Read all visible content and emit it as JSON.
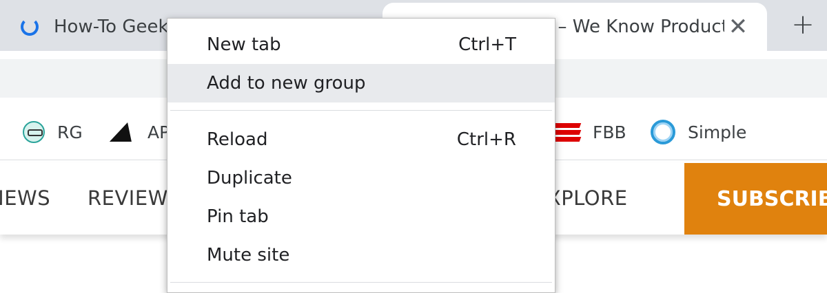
{
  "tabs": [
    {
      "title": "How-To Geek – We Explain Technology",
      "active": false,
      "loading": true
    },
    {
      "title": "Review Geek – We Know Products",
      "active": true
    }
  ],
  "tab_close_glyph": "✕",
  "new_tab_glyph": "+",
  "bookmarks": [
    {
      "label": "RG",
      "icon": "review-geek-icon"
    },
    {
      "label": "AP",
      "icon": "android-police-icon"
    },
    {
      "label": "FBB",
      "icon": "espn-icon"
    },
    {
      "label": "Simple",
      "icon": "simple-icon"
    }
  ],
  "site_nav": {
    "items": [
      "NEWS",
      "REVIEWS",
      "EXPLORE"
    ],
    "subscribe_label": "SUBSCRIBE",
    "subscribe_color": "#e0820e"
  },
  "context_menu": {
    "items": [
      {
        "label": "New tab",
        "shortcut": "Ctrl+T"
      },
      {
        "label": "Add to new group",
        "shortcut": "",
        "highlighted": true
      },
      {
        "label": "Reload",
        "shortcut": "Ctrl+R"
      },
      {
        "label": "Duplicate",
        "shortcut": ""
      },
      {
        "label": "Pin tab",
        "shortcut": ""
      },
      {
        "label": "Mute site",
        "shortcut": ""
      }
    ]
  }
}
